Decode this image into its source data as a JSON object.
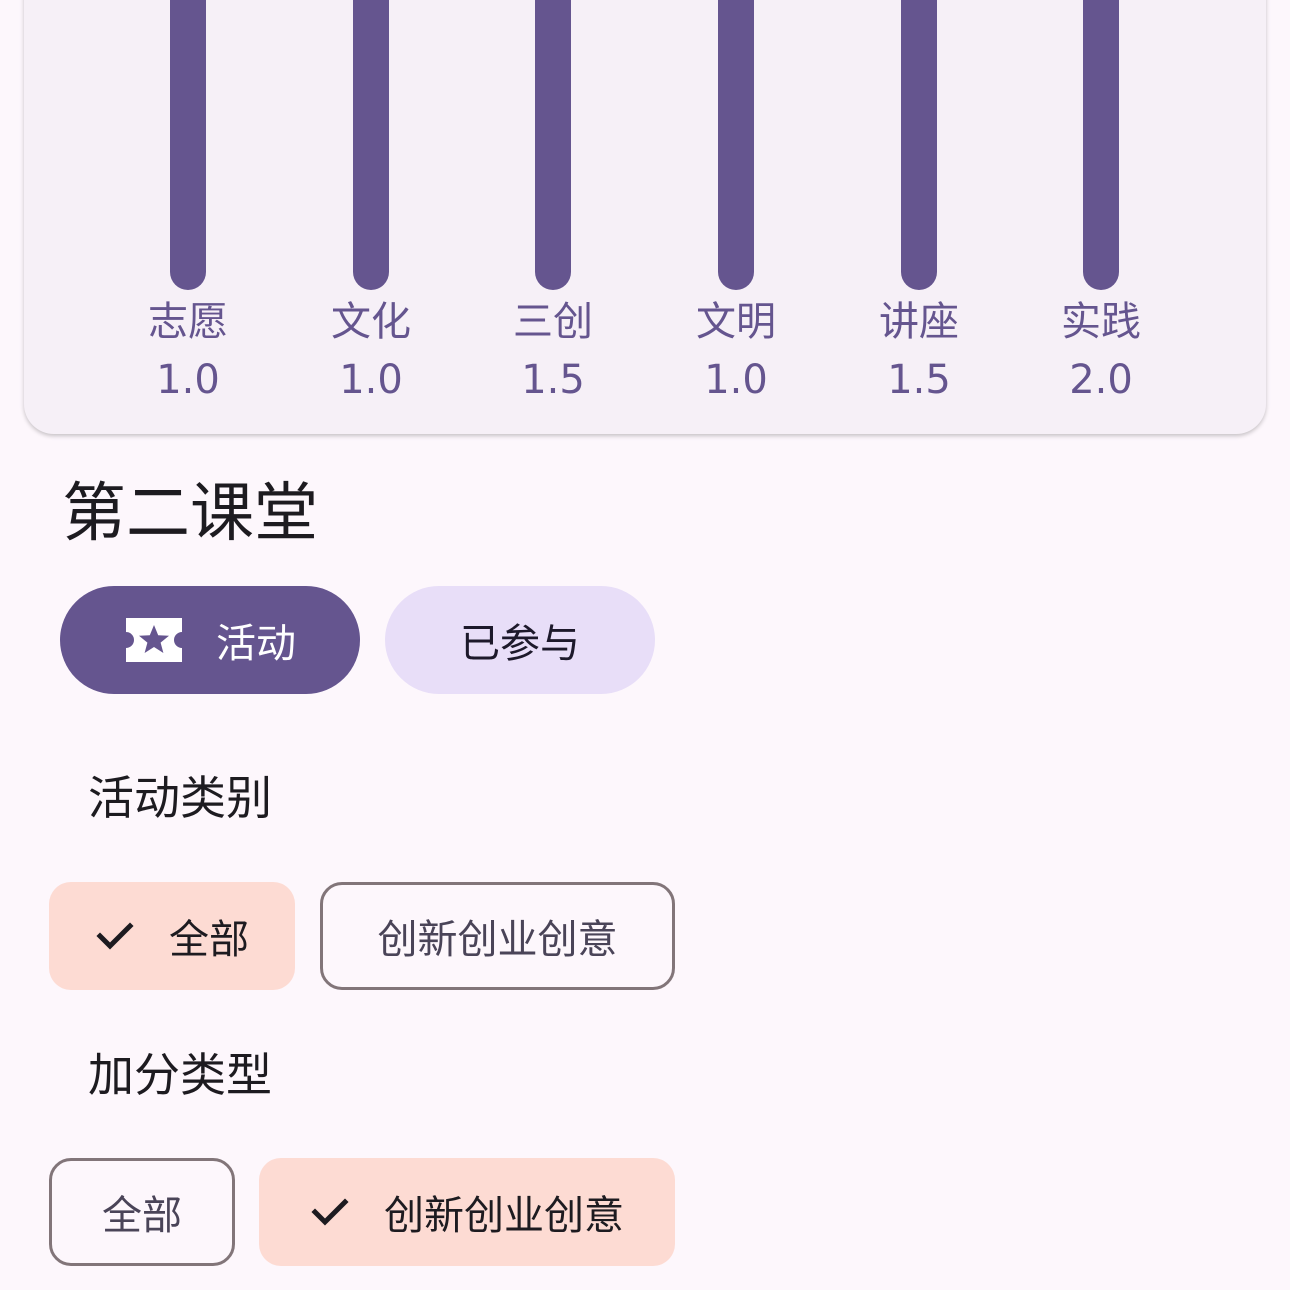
{
  "chart_data": {
    "type": "bar",
    "categories": [
      "志愿",
      "文化",
      "三创",
      "文明",
      "讲座",
      "实践"
    ],
    "values": [
      1.0,
      1.0,
      1.5,
      1.0,
      1.5,
      2.0
    ],
    "value_labels": [
      "1.0",
      "1.0",
      "1.5",
      "1.0",
      "1.5",
      "2.0"
    ],
    "bar_color": "#65558f"
  },
  "section": {
    "title": "第二课堂"
  },
  "tabs": [
    {
      "label": "活动",
      "icon": "ticket-star-icon",
      "selected": true
    },
    {
      "label": "已参与",
      "selected": false
    }
  ],
  "filters": {
    "activity_type": {
      "label": "活动类别",
      "options": [
        {
          "label": "全部",
          "selected": true
        },
        {
          "label": "创新创业创意",
          "selected": false
        }
      ]
    },
    "score_type": {
      "label": "加分类型",
      "options": [
        {
          "label": "全部",
          "selected": false
        },
        {
          "label": "创新创业创意",
          "selected": true
        }
      ]
    }
  },
  "colors": {
    "primary": "#65558f",
    "secondary_container": "#e8def8",
    "chip_selected": "#fddbd3",
    "outline": "#827579",
    "background": "#fdf7fc"
  }
}
